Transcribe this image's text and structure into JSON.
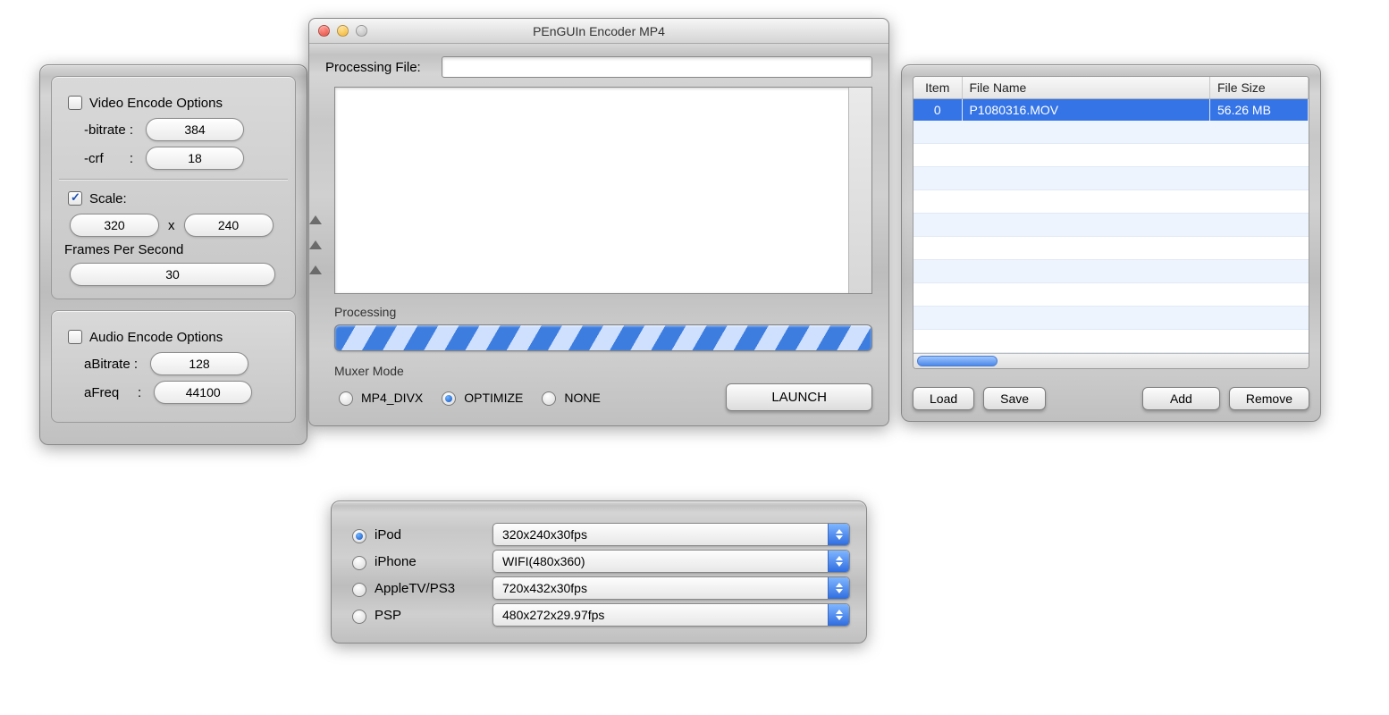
{
  "window": {
    "title": "PEnGUIn Encoder MP4"
  },
  "video": {
    "header": "Video Encode Options",
    "checked": false,
    "bitrate_label": "-bitrate :",
    "bitrate": "384",
    "crf_label": "-crf       :",
    "crf": "18",
    "scale_label": "Scale:",
    "scale_checked": true,
    "scale_w": "320",
    "scale_x": "x",
    "scale_h": "240",
    "fps_label": "Frames Per Second",
    "fps": "30"
  },
  "audio": {
    "header": "Audio Encode Options",
    "checked": false,
    "abitrate_label": "aBitrate :",
    "abitrate": "128",
    "afreq_label": "aFreq     :",
    "afreq": "44100"
  },
  "main": {
    "processing_label": "Processing File:",
    "processing_value": "",
    "processing_section": "Processing",
    "muxer_label": "Muxer Mode",
    "muxer_options": [
      "MP4_DIVX",
      "OPTIMIZE",
      "NONE"
    ],
    "muxer_selected": "OPTIMIZE",
    "launch": "LAUNCH"
  },
  "presets": {
    "rows": [
      {
        "name": "iPod",
        "value": "320x240x30fps",
        "selected": true
      },
      {
        "name": "iPhone",
        "value": "WIFI(480x360)",
        "selected": false
      },
      {
        "name": "AppleTV/PS3",
        "value": "720x432x30fps",
        "selected": false
      },
      {
        "name": "PSP",
        "value": "480x272x29.97fps",
        "selected": false
      }
    ]
  },
  "files": {
    "columns": [
      "Item",
      "File Name",
      "File Size"
    ],
    "rows": [
      {
        "item": "0",
        "name": "P1080316.MOV",
        "size": "56.26 MB",
        "selected": true
      }
    ],
    "blank_rows": 10,
    "buttons": {
      "load": "Load",
      "save": "Save",
      "add": "Add",
      "remove": "Remove"
    }
  }
}
